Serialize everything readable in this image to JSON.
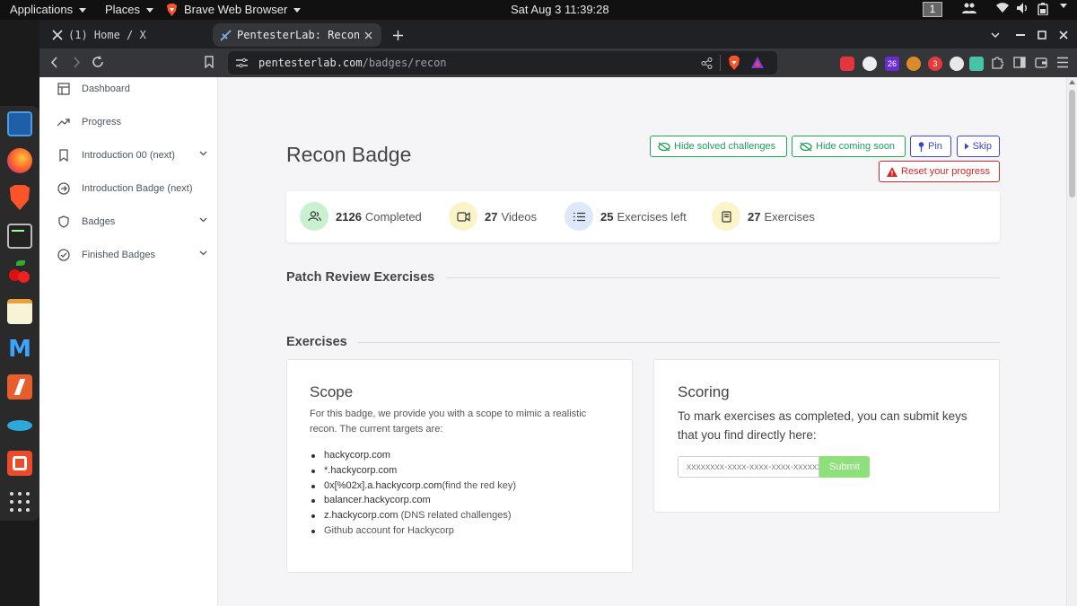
{
  "topbar": {
    "applications": "Applications",
    "places": "Places",
    "app_name": "Brave Web Browser",
    "clock": "Sat Aug 3  11:39:28",
    "workspace": "1"
  },
  "browser": {
    "tabs": [
      {
        "label": "(1) Home / X",
        "icon": "x-logo-icon"
      },
      {
        "label": "PentesterLab: Recon",
        "icon": "pentesterlab-icon"
      }
    ],
    "url": {
      "host": "pentesterlab.com",
      "path": "/badges/recon"
    },
    "ext_badges": {
      "first": "26",
      "second": "3"
    }
  },
  "sidebar": {
    "items": [
      {
        "label": "Dashboard",
        "icon": "dashboard-icon"
      },
      {
        "label": "Progress",
        "icon": "trend-icon"
      },
      {
        "label": "Introduction 00 (next)",
        "icon": "bookmark-icon"
      },
      {
        "label": "Introduction Badge (next)",
        "icon": "arrow-circle-icon"
      },
      {
        "label": "Badges",
        "icon": "shield-icon"
      },
      {
        "label": "Finished Badges",
        "icon": "check-circle-icon"
      }
    ]
  },
  "main": {
    "title": "Recon Badge",
    "buttons": {
      "hide_solved": "Hide solved challenges",
      "hide_coming": "Hide coming soon",
      "pin": "Pin",
      "skip": "Skip",
      "reset": "Reset your progress"
    },
    "stats": [
      {
        "value": "2126",
        "label": "Completed",
        "icon": "users-icon",
        "color": "#c9f1cf"
      },
      {
        "value": "27",
        "label": "Videos",
        "icon": "video-icon",
        "color": "#fbf4c8"
      },
      {
        "value": "25",
        "label": "Exercises left",
        "icon": "list-icon",
        "color": "#dde8fb"
      },
      {
        "value": "27",
        "label": "Exercises",
        "icon": "book-icon",
        "color": "#fbf4c8"
      }
    ],
    "sections": {
      "patch_review": "Patch Review Exercises",
      "exercises": "Exercises"
    },
    "scope": {
      "title": "Scope",
      "description": "For this badge, we provide you with a scope to mimic a realistic recon. The current targets are:",
      "targets": [
        {
          "text": "hackycorp.com",
          "note": ""
        },
        {
          "text": "*.hackycorp.com",
          "note": ""
        },
        {
          "text": "0x[%02x].a.hackycorp.com",
          "note": "(find the red key)"
        },
        {
          "text": "balancer.hackycorp.com",
          "note": ""
        },
        {
          "text": "z.hackycorp.com",
          "note": " (DNS related challenges)"
        },
        {
          "text": "",
          "note": "Github account for Hackycorp"
        }
      ]
    },
    "scoring": {
      "title": "Scoring",
      "description": "To mark exercises as completed, you can submit keys that you find directly here:",
      "input_placeholder": "xxxxxxxx-xxxx-xxxx-xxxx-xxxxxxxxxxxx",
      "submit": "Submit"
    }
  },
  "colors": {
    "green": "#1f9d55",
    "blue": "#3a45c8",
    "red": "#d72727",
    "submit": "#8ee07a"
  }
}
